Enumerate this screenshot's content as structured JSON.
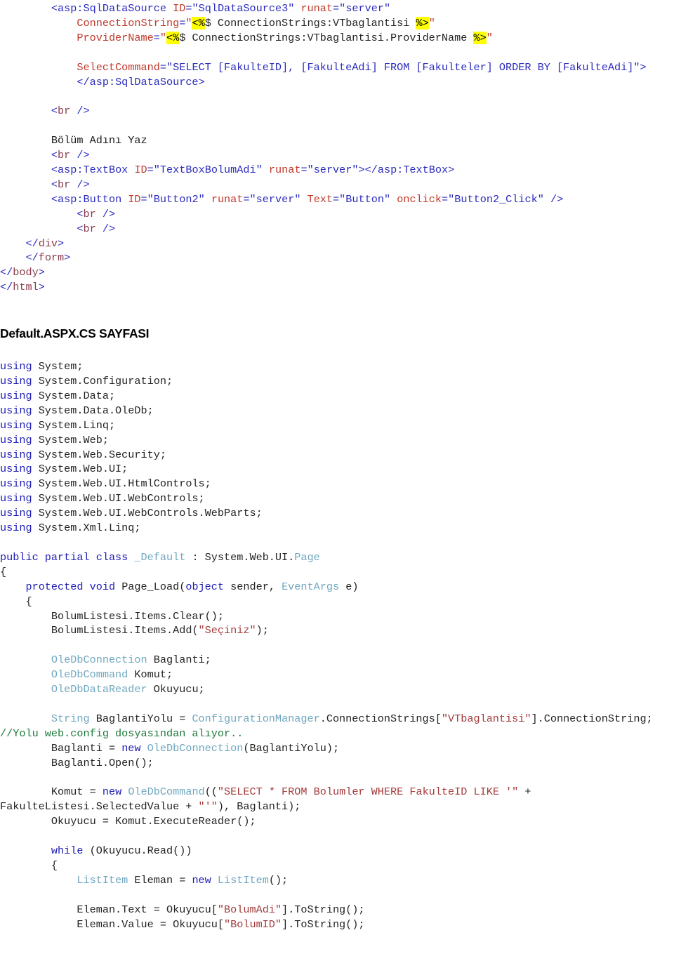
{
  "document": {
    "type": "source-code-listing",
    "language_top": "ASP.NET (ASPX markup)",
    "language_bottom": "C#",
    "section_heading": "Default.ASPX.CS SAYFASI"
  },
  "colors": {
    "keyword": "#1d1db5",
    "type": "#6fa7bf",
    "string": "#a33b3b",
    "comment": "#1e7a3c",
    "markup_tag": "#2b2bbe",
    "markup_attribute": "#c0392b",
    "highlight_background": "#ffff00",
    "page_background": "#ffffff",
    "default_text": "#1a1a1a"
  },
  "aspx": {
    "lines": [
      {
        "indent": 8,
        "tokens": [
          {
            "t": "punc",
            "v": "<"
          },
          {
            "t": "tag",
            "v": "asp:SqlDataSource"
          },
          {
            "t": "plain",
            "v": " "
          },
          {
            "t": "attr",
            "v": "ID"
          },
          {
            "t": "punc",
            "v": "="
          },
          {
            "t": "aval",
            "v": "\"SqlDataSource3\""
          },
          {
            "t": "plain",
            "v": " "
          },
          {
            "t": "attr",
            "v": "runat"
          },
          {
            "t": "punc",
            "v": "="
          },
          {
            "t": "aval",
            "v": "\"server\""
          }
        ]
      },
      {
        "indent": 12,
        "tokens": [
          {
            "t": "attr",
            "v": "ConnectionString"
          },
          {
            "t": "punc",
            "v": "="
          },
          {
            "t": "attr",
            "v": "\""
          },
          {
            "t": "hl",
            "v": "<%"
          },
          {
            "t": "plain",
            "v": "$ ConnectionStrings:VTbaglantisi "
          },
          {
            "t": "hl",
            "v": "%>"
          },
          {
            "t": "attr",
            "v": "\""
          }
        ]
      },
      {
        "indent": 12,
        "tokens": [
          {
            "t": "attr",
            "v": "ProviderName"
          },
          {
            "t": "punc",
            "v": "="
          },
          {
            "t": "attr",
            "v": "\""
          },
          {
            "t": "hl",
            "v": "<%"
          },
          {
            "t": "plain",
            "v": "$ ConnectionStrings:VTbaglantisi.ProviderName "
          },
          {
            "t": "hl",
            "v": "%>"
          },
          {
            "t": "attr",
            "v": "\""
          }
        ]
      },
      {
        "indent": 0,
        "tokens": []
      },
      {
        "indent": 12,
        "tokens": [
          {
            "t": "attr",
            "v": "SelectCommand"
          },
          {
            "t": "punc",
            "v": "="
          },
          {
            "t": "aval",
            "v": "\"SELECT [FakulteID], [FakulteAdi] FROM [Fakulteler] ORDER BY [FakulteAdi]\""
          },
          {
            "t": "punc",
            "v": ">"
          }
        ]
      },
      {
        "indent": 12,
        "tokens": [
          {
            "t": "punc",
            "v": "</"
          },
          {
            "t": "tag",
            "v": "asp:SqlDataSource"
          },
          {
            "t": "punc",
            "v": ">"
          }
        ]
      },
      {
        "indent": 0,
        "tokens": []
      },
      {
        "indent": 8,
        "tokens": [
          {
            "t": "punc",
            "v": "<"
          },
          {
            "t": "brtag",
            "v": "br"
          },
          {
            "t": "punc",
            "v": " />"
          }
        ]
      },
      {
        "indent": 0,
        "tokens": []
      },
      {
        "indent": 8,
        "tokens": [
          {
            "t": "txt",
            "v": "Bölüm Adını Yaz"
          }
        ]
      },
      {
        "indent": 8,
        "tokens": [
          {
            "t": "punc",
            "v": "<"
          },
          {
            "t": "brtag",
            "v": "br"
          },
          {
            "t": "punc",
            "v": " />"
          }
        ]
      },
      {
        "indent": 8,
        "tokens": [
          {
            "t": "punc",
            "v": "<"
          },
          {
            "t": "tag",
            "v": "asp:TextBox"
          },
          {
            "t": "plain",
            "v": " "
          },
          {
            "t": "attr",
            "v": "ID"
          },
          {
            "t": "punc",
            "v": "="
          },
          {
            "t": "aval",
            "v": "\"TextBoxBolumAdi\""
          },
          {
            "t": "plain",
            "v": " "
          },
          {
            "t": "attr",
            "v": "runat"
          },
          {
            "t": "punc",
            "v": "="
          },
          {
            "t": "aval",
            "v": "\"server\""
          },
          {
            "t": "punc",
            "v": ">"
          },
          {
            "t": "punc",
            "v": "</"
          },
          {
            "t": "tag",
            "v": "asp:TextBox"
          },
          {
            "t": "punc",
            "v": ">"
          }
        ]
      },
      {
        "indent": 8,
        "tokens": [
          {
            "t": "punc",
            "v": "<"
          },
          {
            "t": "brtag",
            "v": "br"
          },
          {
            "t": "punc",
            "v": " />"
          }
        ]
      },
      {
        "indent": 8,
        "tokens": [
          {
            "t": "punc",
            "v": "<"
          },
          {
            "t": "tag",
            "v": "asp:Button"
          },
          {
            "t": "plain",
            "v": " "
          },
          {
            "t": "attr",
            "v": "ID"
          },
          {
            "t": "punc",
            "v": "="
          },
          {
            "t": "aval",
            "v": "\"Button2\""
          },
          {
            "t": "plain",
            "v": " "
          },
          {
            "t": "attr",
            "v": "runat"
          },
          {
            "t": "punc",
            "v": "="
          },
          {
            "t": "aval",
            "v": "\"server\""
          },
          {
            "t": "plain",
            "v": " "
          },
          {
            "t": "attr",
            "v": "Text"
          },
          {
            "t": "punc",
            "v": "="
          },
          {
            "t": "aval",
            "v": "\"Button\""
          },
          {
            "t": "plain",
            "v": " "
          },
          {
            "t": "attr",
            "v": "onclick"
          },
          {
            "t": "punc",
            "v": "="
          },
          {
            "t": "aval",
            "v": "\"Button2_Click\""
          },
          {
            "t": "punc",
            "v": " />"
          }
        ]
      },
      {
        "indent": 12,
        "tokens": [
          {
            "t": "punc",
            "v": "<"
          },
          {
            "t": "brtag",
            "v": "br"
          },
          {
            "t": "punc",
            "v": " />"
          }
        ]
      },
      {
        "indent": 12,
        "tokens": [
          {
            "t": "punc",
            "v": "<"
          },
          {
            "t": "brtag",
            "v": "br"
          },
          {
            "t": "punc",
            "v": " />"
          }
        ]
      },
      {
        "indent": 4,
        "tokens": [
          {
            "t": "punc",
            "v": "</"
          },
          {
            "t": "brtag",
            "v": "div"
          },
          {
            "t": "punc",
            "v": ">"
          }
        ]
      },
      {
        "indent": 4,
        "tokens": [
          {
            "t": "punc",
            "v": "</"
          },
          {
            "t": "brtag",
            "v": "form"
          },
          {
            "t": "punc",
            "v": ">"
          }
        ]
      },
      {
        "indent": 0,
        "tokens": [
          {
            "t": "punc",
            "v": "</"
          },
          {
            "t": "brtag",
            "v": "body"
          },
          {
            "t": "punc",
            "v": ">"
          }
        ]
      },
      {
        "indent": 0,
        "tokens": [
          {
            "t": "punc",
            "v": "</"
          },
          {
            "t": "brtag",
            "v": "html"
          },
          {
            "t": "punc",
            "v": ">"
          }
        ]
      }
    ]
  },
  "csharp": {
    "lines": [
      {
        "indent": 0,
        "tokens": [
          {
            "t": "k",
            "v": "using"
          },
          {
            "t": "plain",
            "v": " System;"
          }
        ]
      },
      {
        "indent": 0,
        "tokens": [
          {
            "t": "k",
            "v": "using"
          },
          {
            "t": "plain",
            "v": " System.Configuration;"
          }
        ]
      },
      {
        "indent": 0,
        "tokens": [
          {
            "t": "k",
            "v": "using"
          },
          {
            "t": "plain",
            "v": " System.Data;"
          }
        ]
      },
      {
        "indent": 0,
        "tokens": [
          {
            "t": "k",
            "v": "using"
          },
          {
            "t": "plain",
            "v": " System.Data.OleDb;"
          }
        ]
      },
      {
        "indent": 0,
        "tokens": [
          {
            "t": "k",
            "v": "using"
          },
          {
            "t": "plain",
            "v": " System.Linq;"
          }
        ]
      },
      {
        "indent": 0,
        "tokens": [
          {
            "t": "k",
            "v": "using"
          },
          {
            "t": "plain",
            "v": " System.Web;"
          }
        ]
      },
      {
        "indent": 0,
        "tokens": [
          {
            "t": "k",
            "v": "using"
          },
          {
            "t": "plain",
            "v": " System.Web.Security;"
          }
        ]
      },
      {
        "indent": 0,
        "tokens": [
          {
            "t": "k",
            "v": "using"
          },
          {
            "t": "plain",
            "v": " System.Web.UI;"
          }
        ]
      },
      {
        "indent": 0,
        "tokens": [
          {
            "t": "k",
            "v": "using"
          },
          {
            "t": "plain",
            "v": " System.Web.UI.HtmlControls;"
          }
        ]
      },
      {
        "indent": 0,
        "tokens": [
          {
            "t": "k",
            "v": "using"
          },
          {
            "t": "plain",
            "v": " System.Web.UI.WebControls;"
          }
        ]
      },
      {
        "indent": 0,
        "tokens": [
          {
            "t": "k",
            "v": "using"
          },
          {
            "t": "plain",
            "v": " System.Web.UI.WebControls.WebParts;"
          }
        ]
      },
      {
        "indent": 0,
        "tokens": [
          {
            "t": "k",
            "v": "using"
          },
          {
            "t": "plain",
            "v": " System.Xml.Linq;"
          }
        ]
      },
      {
        "indent": 0,
        "tokens": []
      },
      {
        "indent": 0,
        "tokens": [
          {
            "t": "k",
            "v": "public partial class"
          },
          {
            "t": "plain",
            "v": " "
          },
          {
            "t": "type",
            "v": "_Default"
          },
          {
            "t": "plain",
            "v": " : System.Web.UI."
          },
          {
            "t": "type",
            "v": "Page"
          }
        ]
      },
      {
        "indent": 0,
        "tokens": [
          {
            "t": "plain",
            "v": "{"
          }
        ]
      },
      {
        "indent": 4,
        "tokens": [
          {
            "t": "k",
            "v": "protected void"
          },
          {
            "t": "plain",
            "v": " Page_Load("
          },
          {
            "t": "k",
            "v": "object"
          },
          {
            "t": "plain",
            "v": " sender, "
          },
          {
            "t": "type",
            "v": "EventArgs"
          },
          {
            "t": "plain",
            "v": " e)"
          }
        ]
      },
      {
        "indent": 4,
        "tokens": [
          {
            "t": "plain",
            "v": "{"
          }
        ]
      },
      {
        "indent": 8,
        "tokens": [
          {
            "t": "plain",
            "v": "BolumListesi.Items.Clear();"
          }
        ]
      },
      {
        "indent": 8,
        "tokens": [
          {
            "t": "plain",
            "v": "BolumListesi.Items.Add("
          },
          {
            "t": "str",
            "v": "\"Seçiniz\""
          },
          {
            "t": "plain",
            "v": ");"
          }
        ]
      },
      {
        "indent": 0,
        "tokens": []
      },
      {
        "indent": 8,
        "tokens": [
          {
            "t": "type",
            "v": "OleDbConnection"
          },
          {
            "t": "plain",
            "v": " Baglanti;"
          }
        ]
      },
      {
        "indent": 8,
        "tokens": [
          {
            "t": "type",
            "v": "OleDbCommand"
          },
          {
            "t": "plain",
            "v": " Komut;"
          }
        ]
      },
      {
        "indent": 8,
        "tokens": [
          {
            "t": "type",
            "v": "OleDbDataReader"
          },
          {
            "t": "plain",
            "v": " Okuyucu;"
          }
        ]
      },
      {
        "indent": 0,
        "tokens": []
      },
      {
        "indent": 8,
        "tokens": [
          {
            "t": "type",
            "v": "String"
          },
          {
            "t": "plain",
            "v": " BaglantiYolu = "
          },
          {
            "t": "type",
            "v": "ConfigurationManager"
          },
          {
            "t": "plain",
            "v": ".ConnectionStrings["
          },
          {
            "t": "str",
            "v": "\"VTbaglantisi\""
          },
          {
            "t": "plain",
            "v": "].ConnectionString; "
          },
          {
            "t": "cmt",
            "v": "//Yolu web.config dosyasından alıyor.."
          }
        ]
      },
      {
        "indent": 8,
        "tokens": [
          {
            "t": "plain",
            "v": "Baglanti = "
          },
          {
            "t": "k",
            "v": "new"
          },
          {
            "t": "plain",
            "v": " "
          },
          {
            "t": "type",
            "v": "OleDbConnection"
          },
          {
            "t": "plain",
            "v": "(BaglantiYolu);"
          }
        ]
      },
      {
        "indent": 8,
        "tokens": [
          {
            "t": "plain",
            "v": "Baglanti.Open();"
          }
        ]
      },
      {
        "indent": 0,
        "tokens": []
      },
      {
        "indent": 8,
        "tokens": [
          {
            "t": "plain",
            "v": "Komut = "
          },
          {
            "t": "k",
            "v": "new"
          },
          {
            "t": "plain",
            "v": " "
          },
          {
            "t": "type",
            "v": "OleDbCommand"
          },
          {
            "t": "plain",
            "v": "(("
          },
          {
            "t": "str",
            "v": "\"SELECT * FROM Bolumler WHERE FakulteID LIKE '\""
          },
          {
            "t": "plain",
            "v": " + FakulteListesi.SelectedValue + "
          },
          {
            "t": "str",
            "v": "\"'\""
          },
          {
            "t": "plain",
            "v": "), Baglanti);"
          }
        ]
      },
      {
        "indent": 8,
        "tokens": [
          {
            "t": "plain",
            "v": "Okuyucu = Komut.ExecuteReader();"
          }
        ]
      },
      {
        "indent": 0,
        "tokens": []
      },
      {
        "indent": 8,
        "tokens": [
          {
            "t": "k",
            "v": "while"
          },
          {
            "t": "plain",
            "v": " (Okuyucu.Read())"
          }
        ]
      },
      {
        "indent": 8,
        "tokens": [
          {
            "t": "plain",
            "v": "{"
          }
        ]
      },
      {
        "indent": 12,
        "tokens": [
          {
            "t": "type",
            "v": "ListItem"
          },
          {
            "t": "plain",
            "v": " Eleman = "
          },
          {
            "t": "k",
            "v": "new"
          },
          {
            "t": "plain",
            "v": " "
          },
          {
            "t": "type",
            "v": "ListItem"
          },
          {
            "t": "plain",
            "v": "();"
          }
        ]
      },
      {
        "indent": 0,
        "tokens": []
      },
      {
        "indent": 12,
        "tokens": [
          {
            "t": "plain",
            "v": "Eleman.Text = Okuyucu["
          },
          {
            "t": "str",
            "v": "\"BolumAdi\""
          },
          {
            "t": "plain",
            "v": "].ToString();"
          }
        ]
      },
      {
        "indent": 12,
        "tokens": [
          {
            "t": "plain",
            "v": "Eleman.Value = Okuyucu["
          },
          {
            "t": "str",
            "v": "\"BolumID\""
          },
          {
            "t": "plain",
            "v": "].ToString();"
          }
        ]
      }
    ]
  }
}
